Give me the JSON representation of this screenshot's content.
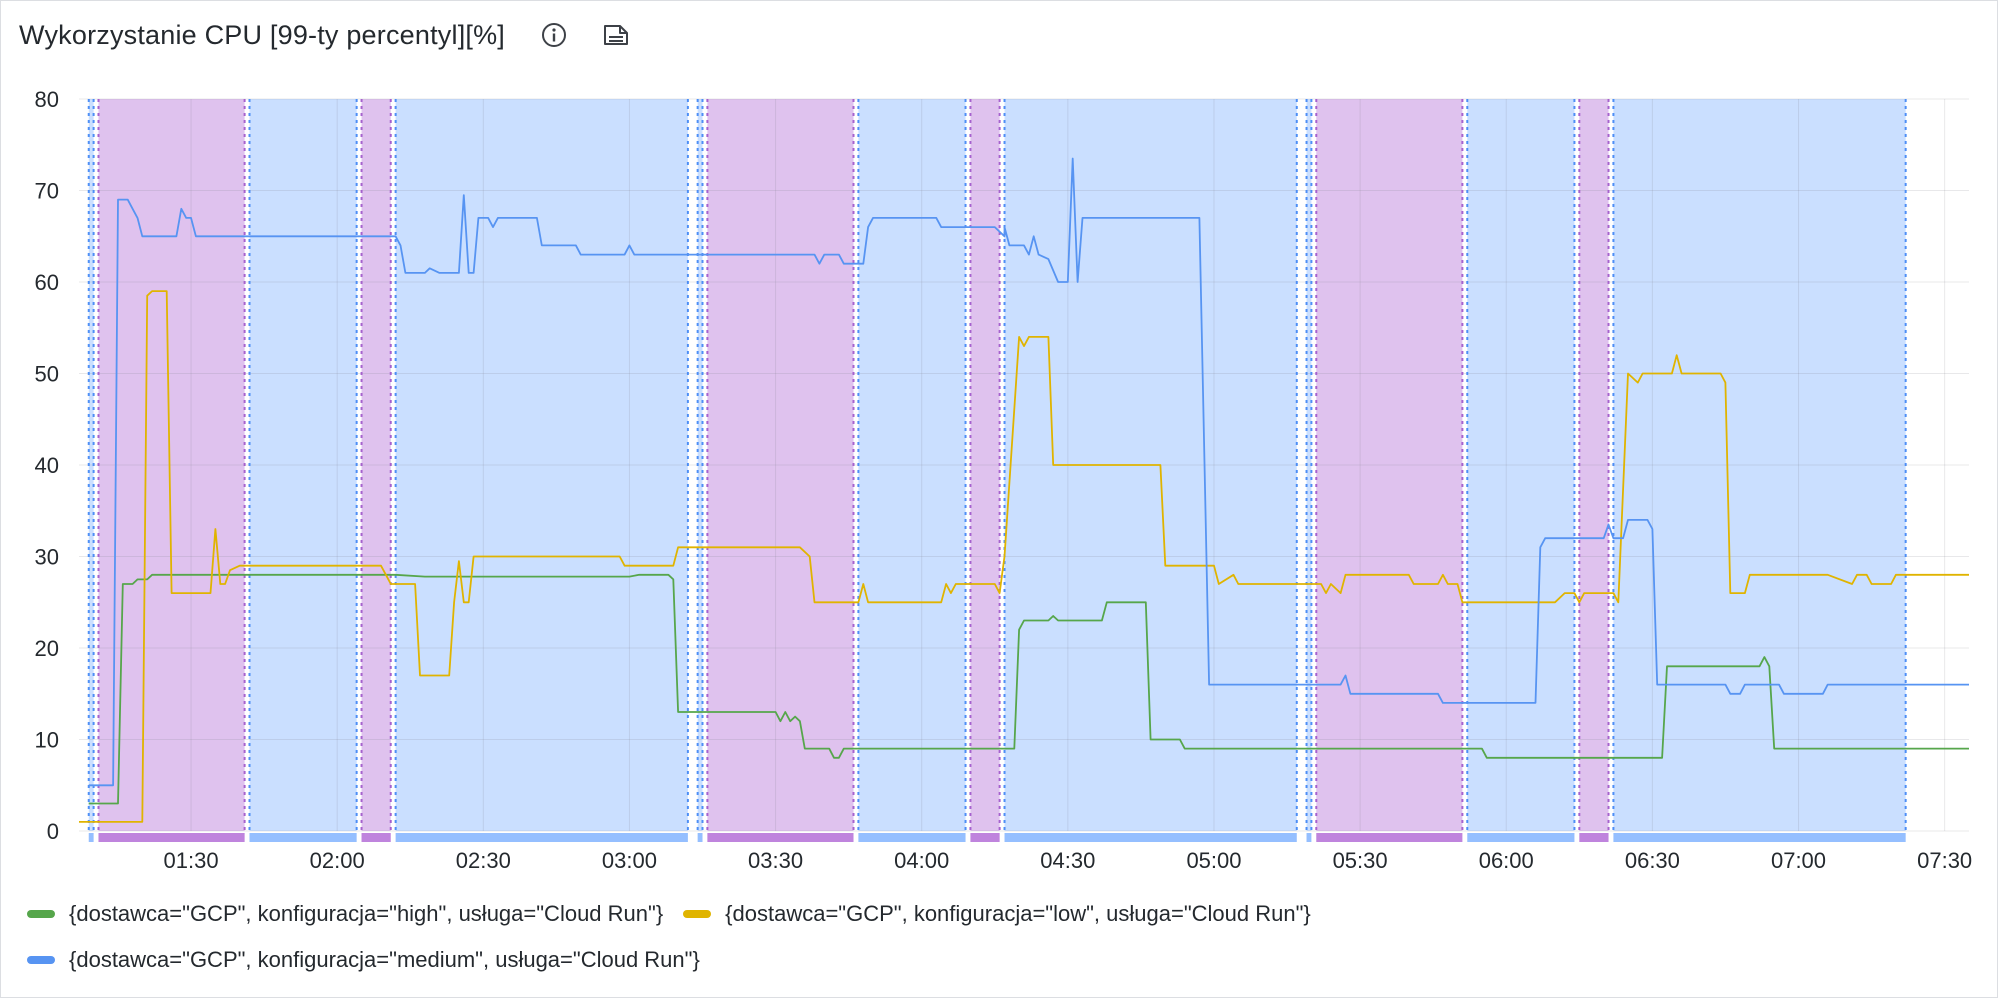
{
  "panel": {
    "title": "Wykorzystanie CPU [99-ty percentyl][%]",
    "icons": [
      "info-icon",
      "description-icon"
    ]
  },
  "legend": {
    "items": [
      {
        "label": "{dostawca=\"GCP\", konfiguracja=\"high\", usługa=\"Cloud Run\"}",
        "color": "#56a64b"
      },
      {
        "label": "{dostawca=\"GCP\", konfiguracja=\"low\", usługa=\"Cloud Run\"}",
        "color": "#e0b400"
      },
      {
        "label": "{dostawca=\"GCP\", konfiguracja=\"medium\", usługa=\"Cloud Run\"}",
        "color": "#3274d9"
      }
    ]
  },
  "chart_data": {
    "type": "line",
    "title": "Wykorzystanie CPU [99-ty percentyl][%]",
    "xlabel": "",
    "ylabel": "",
    "ylim": [
      0,
      80
    ],
    "yticks": [
      0,
      10,
      20,
      30,
      40,
      50,
      60,
      70,
      80
    ],
    "xlim": [
      "01:07",
      "07:35"
    ],
    "xticks": [
      "01:30",
      "02:00",
      "02:30",
      "03:00",
      "03:30",
      "04:00",
      "04:30",
      "05:00",
      "05:30",
      "06:00",
      "06:30",
      "07:00",
      "07:30"
    ],
    "grid": true,
    "legend_position": "bottom",
    "region_colors": {
      "purple": "#b877d9",
      "blue": "#8ab8ff"
    },
    "regions": [
      {
        "start": "01:09",
        "end": "01:10",
        "color": "blue"
      },
      {
        "start": "01:11",
        "end": "01:41",
        "color": "purple"
      },
      {
        "start": "01:42",
        "end": "02:04",
        "color": "blue"
      },
      {
        "start": "02:05",
        "end": "02:11",
        "color": "purple"
      },
      {
        "start": "02:12",
        "end": "03:12",
        "color": "blue"
      },
      {
        "start": "03:14",
        "end": "03:15",
        "color": "blue"
      },
      {
        "start": "03:16",
        "end": "03:46",
        "color": "purple"
      },
      {
        "start": "03:47",
        "end": "04:09",
        "color": "blue"
      },
      {
        "start": "04:10",
        "end": "04:16",
        "color": "purple"
      },
      {
        "start": "04:17",
        "end": "05:17",
        "color": "blue"
      },
      {
        "start": "05:19",
        "end": "05:20",
        "color": "blue"
      },
      {
        "start": "05:21",
        "end": "05:51",
        "color": "purple"
      },
      {
        "start": "05:52",
        "end": "06:14",
        "color": "blue"
      },
      {
        "start": "06:15",
        "end": "06:21",
        "color": "purple"
      },
      {
        "start": "06:22",
        "end": "07:22",
        "color": "blue"
      }
    ],
    "series": [
      {
        "name": "{dostawca=\"GCP\", konfiguracja=\"high\", usługa=\"Cloud Run\"}",
        "color": "#56a64b",
        "points": [
          [
            "01:09",
            3
          ],
          [
            "01:15",
            3
          ],
          [
            "01:16",
            27
          ],
          [
            "01:18",
            27
          ],
          [
            "01:19",
            27.5
          ],
          [
            "01:21",
            27.5
          ],
          [
            "01:22",
            28
          ],
          [
            "02:12",
            28
          ],
          [
            "02:18",
            27.8
          ],
          [
            "03:00",
            27.8
          ],
          [
            "03:02",
            28
          ],
          [
            "03:08",
            28
          ],
          [
            "03:09",
            27.5
          ],
          [
            "03:10",
            13
          ],
          [
            "03:30",
            13
          ],
          [
            "03:31",
            12
          ],
          [
            "03:32",
            13
          ],
          [
            "03:33",
            12
          ],
          [
            "03:34",
            12.5
          ],
          [
            "03:35",
            12
          ],
          [
            "03:36",
            9
          ],
          [
            "03:41",
            9
          ],
          [
            "03:42",
            8
          ],
          [
            "03:43",
            8
          ],
          [
            "03:44",
            9
          ],
          [
            "04:19",
            9
          ],
          [
            "04:20",
            22
          ],
          [
            "04:21",
            23
          ],
          [
            "04:26",
            23
          ],
          [
            "04:27",
            23.5
          ],
          [
            "04:28",
            23
          ],
          [
            "04:37",
            23
          ],
          [
            "04:38",
            25
          ],
          [
            "04:46",
            25
          ],
          [
            "04:47",
            10
          ],
          [
            "04:53",
            10
          ],
          [
            "04:54",
            9
          ],
          [
            "05:55",
            9
          ],
          [
            "05:56",
            8
          ],
          [
            "06:32",
            8
          ],
          [
            "06:33",
            18
          ],
          [
            "06:52",
            18
          ],
          [
            "06:53",
            19
          ],
          [
            "06:54",
            18
          ],
          [
            "06:55",
            9
          ],
          [
            "07:35",
            9
          ]
        ]
      },
      {
        "name": "{dostawca=\"GCP\", konfiguracja=\"low\", usługa=\"Cloud Run\"}",
        "color": "#e0b400",
        "points": [
          [
            "01:07",
            1
          ],
          [
            "01:20",
            1
          ],
          [
            "01:21",
            58.5
          ],
          [
            "01:22",
            59
          ],
          [
            "01:25",
            59
          ],
          [
            "01:26",
            26
          ],
          [
            "01:34",
            26
          ],
          [
            "01:35",
            33
          ],
          [
            "01:36",
            27
          ],
          [
            "01:37",
            27
          ],
          [
            "01:38",
            28.5
          ],
          [
            "01:40",
            29
          ],
          [
            "02:09",
            29
          ],
          [
            "02:10",
            28
          ],
          [
            "02:11",
            27
          ],
          [
            "02:16",
            27
          ],
          [
            "02:17",
            17
          ],
          [
            "02:23",
            17
          ],
          [
            "02:24",
            25
          ],
          [
            "02:25",
            29.5
          ],
          [
            "02:26",
            25
          ],
          [
            "02:27",
            25
          ],
          [
            "02:28",
            30
          ],
          [
            "02:58",
            30
          ],
          [
            "02:59",
            29
          ],
          [
            "03:09",
            29
          ],
          [
            "03:10",
            31
          ],
          [
            "03:33",
            31
          ],
          [
            "03:35",
            31
          ],
          [
            "03:37",
            30
          ],
          [
            "03:38",
            25
          ],
          [
            "03:47",
            25
          ],
          [
            "03:48",
            27
          ],
          [
            "03:49",
            25
          ],
          [
            "04:04",
            25
          ],
          [
            "04:05",
            27
          ],
          [
            "04:06",
            26
          ],
          [
            "04:07",
            27
          ],
          [
            "04:15",
            27
          ],
          [
            "04:16",
            26
          ],
          [
            "04:17",
            30
          ],
          [
            "04:20",
            54
          ],
          [
            "04:21",
            53
          ],
          [
            "04:22",
            54
          ],
          [
            "04:26",
            54
          ],
          [
            "04:27",
            40
          ],
          [
            "04:49",
            40
          ],
          [
            "04:50",
            29
          ],
          [
            "05:00",
            29
          ],
          [
            "05:01",
            27
          ],
          [
            "05:04",
            28
          ],
          [
            "05:05",
            27
          ],
          [
            "05:22",
            27
          ],
          [
            "05:23",
            26
          ],
          [
            "05:24",
            27
          ],
          [
            "05:26",
            26
          ],
          [
            "05:27",
            28
          ],
          [
            "05:40",
            28
          ],
          [
            "05:41",
            27
          ],
          [
            "05:46",
            27
          ],
          [
            "05:47",
            28
          ],
          [
            "05:48",
            27
          ],
          [
            "05:50",
            27
          ],
          [
            "05:51",
            25
          ],
          [
            "06:10",
            25
          ],
          [
            "06:12",
            26
          ],
          [
            "06:14",
            26
          ],
          [
            "06:15",
            25
          ],
          [
            "06:16",
            26
          ],
          [
            "06:22",
            26
          ],
          [
            "06:23",
            25
          ],
          [
            "06:25",
            50
          ],
          [
            "06:27",
            49
          ],
          [
            "06:28",
            50
          ],
          [
            "06:34",
            50
          ],
          [
            "06:35",
            52
          ],
          [
            "06:36",
            50
          ],
          [
            "06:44",
            50
          ],
          [
            "06:45",
            49
          ],
          [
            "06:46",
            26
          ],
          [
            "06:49",
            26
          ],
          [
            "06:50",
            28
          ],
          [
            "07:06",
            28
          ],
          [
            "07:11",
            27
          ],
          [
            "07:12",
            28
          ],
          [
            "07:14",
            28
          ],
          [
            "07:15",
            27
          ],
          [
            "07:19",
            27
          ],
          [
            "07:20",
            28
          ],
          [
            "07:35",
            28
          ]
        ]
      },
      {
        "name": "{dostawca=\"GCP\", konfiguracja=\"medium\", usługa=\"Cloud Run\"}",
        "color": "#5794f2",
        "points": [
          [
            "01:09",
            5
          ],
          [
            "01:14",
            5
          ],
          [
            "01:15",
            69
          ],
          [
            "01:17",
            69
          ],
          [
            "01:18",
            68
          ],
          [
            "01:19",
            67
          ],
          [
            "01:20",
            65
          ],
          [
            "01:27",
            65
          ],
          [
            "01:28",
            68
          ],
          [
            "01:29",
            67
          ],
          [
            "01:30",
            67
          ],
          [
            "01:31",
            65
          ],
          [
            "02:12",
            65
          ],
          [
            "02:13",
            64
          ],
          [
            "02:14",
            61
          ],
          [
            "02:18",
            61
          ],
          [
            "02:19",
            61.5
          ],
          [
            "02:21",
            61
          ],
          [
            "02:25",
            61
          ],
          [
            "02:26",
            69.5
          ],
          [
            "02:27",
            61
          ],
          [
            "02:28",
            61
          ],
          [
            "02:29",
            67
          ],
          [
            "02:31",
            67
          ],
          [
            "02:32",
            66
          ],
          [
            "02:33",
            67
          ],
          [
            "02:41",
            67
          ],
          [
            "02:42",
            64
          ],
          [
            "02:49",
            64
          ],
          [
            "02:50",
            63
          ],
          [
            "02:59",
            63
          ],
          [
            "03:00",
            64
          ],
          [
            "03:01",
            63
          ],
          [
            "03:38",
            63
          ],
          [
            "03:39",
            62
          ],
          [
            "03:40",
            63
          ],
          [
            "03:43",
            63
          ],
          [
            "03:44",
            62
          ],
          [
            "03:48",
            62
          ],
          [
            "03:49",
            66
          ],
          [
            "03:50",
            67
          ],
          [
            "03:57",
            67
          ],
          [
            "04:03",
            67
          ],
          [
            "04:04",
            66
          ],
          [
            "04:15",
            66
          ],
          [
            "04:17",
            65
          ],
          [
            "04:17",
            66
          ],
          [
            "04:18",
            64
          ],
          [
            "04:21",
            64
          ],
          [
            "04:22",
            63
          ],
          [
            "04:23",
            65
          ],
          [
            "04:24",
            63
          ],
          [
            "04:26",
            62.5
          ],
          [
            "04:28",
            60
          ],
          [
            "04:30",
            60
          ],
          [
            "04:31",
            73.5
          ],
          [
            "04:32",
            60
          ],
          [
            "04:33",
            67
          ],
          [
            "04:57",
            67
          ],
          [
            "04:59",
            16
          ],
          [
            "05:26",
            16
          ],
          [
            "05:27",
            17
          ],
          [
            "05:28",
            15
          ],
          [
            "05:46",
            15
          ],
          [
            "05:47",
            14
          ],
          [
            "06:04",
            14
          ],
          [
            "06:06",
            14
          ],
          [
            "06:07",
            31
          ],
          [
            "06:08",
            32
          ],
          [
            "06:20",
            32
          ],
          [
            "06:21",
            33.5
          ],
          [
            "06:22",
            32
          ],
          [
            "06:24",
            32
          ],
          [
            "06:25",
            34
          ],
          [
            "06:29",
            34
          ],
          [
            "06:30",
            33
          ],
          [
            "06:31",
            16
          ],
          [
            "06:45",
            16
          ],
          [
            "06:46",
            15
          ],
          [
            "06:48",
            15
          ],
          [
            "06:49",
            16
          ],
          [
            "06:56",
            16
          ],
          [
            "06:57",
            15
          ],
          [
            "07:05",
            15
          ],
          [
            "07:06",
            16
          ],
          [
            "07:35",
            16
          ]
        ]
      }
    ]
  }
}
